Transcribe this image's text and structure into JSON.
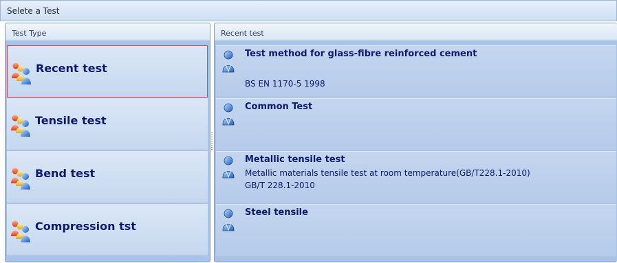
{
  "window": {
    "title": "Selete a Test"
  },
  "left_panel": {
    "header": "Test Type",
    "items": [
      {
        "label": "Recent test",
        "selected": true,
        "icon": "people-icon"
      },
      {
        "label": "Tensile test",
        "selected": false,
        "icon": "people-icon"
      },
      {
        "label": "Bend test",
        "selected": false,
        "icon": "people-icon"
      },
      {
        "label": "Compression tst",
        "selected": false,
        "icon": "people-icon"
      }
    ]
  },
  "right_panel": {
    "header": "Recent test",
    "items": [
      {
        "title": "Test method for glass-fibre reinforced cement",
        "lines": [
          "",
          "BS EN 1170-5 1998"
        ],
        "icon": "person-icon"
      },
      {
        "title": "Common Test",
        "lines": [],
        "icon": "person-icon"
      },
      {
        "title": "Metallic tensile test",
        "lines": [
          "Metallic materials tensile test at room temperature(GB/T228.1-2010)",
          "GB/T 228.1-2010"
        ],
        "icon": "person-icon"
      },
      {
        "title": "Steel tensile",
        "lines": [],
        "icon": "person-icon"
      }
    ]
  },
  "colors": {
    "selected_border": "#d9465b",
    "text": "#0b1a6e",
    "panel_bg": "#a9c3e6"
  }
}
